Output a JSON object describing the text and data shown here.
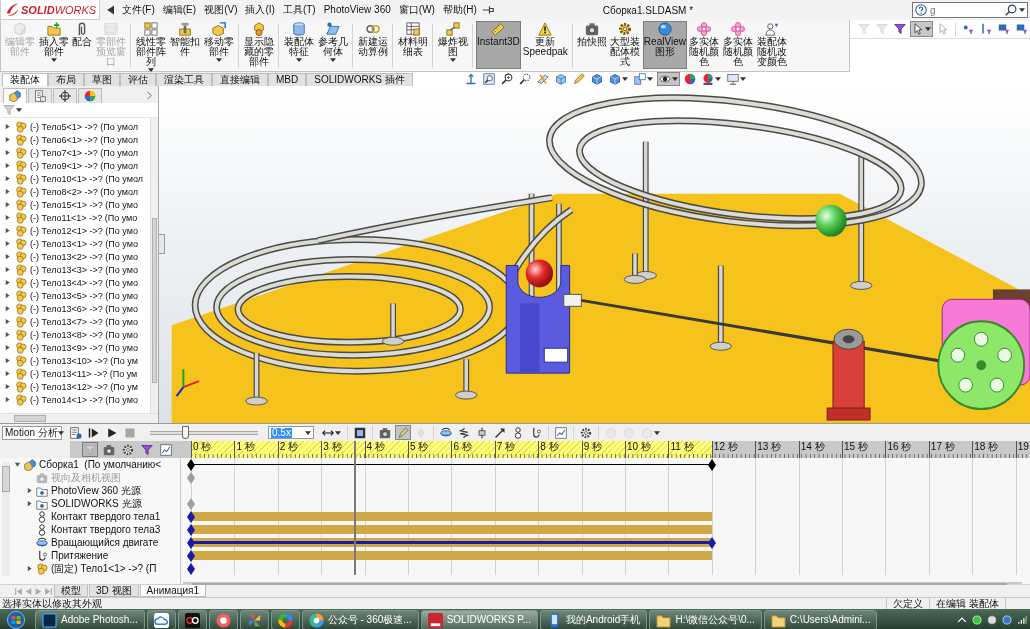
{
  "menu_bar": {
    "logo": "**SOLID**WORKS",
    "items": [
      "文件(F)",
      "编辑(E)",
      "视图(V)",
      "插入(I)",
      "工具(T)",
      "PhotoView 360",
      "窗口(W)",
      "帮助(H)"
    ]
  },
  "window": {
    "title": "Сборка1.SLDASM *"
  },
  "search": {
    "value": "g"
  },
  "command_bar": [
    {
      "label": "编辑零部件",
      "disabled": true,
      "selected": false,
      "has_menu": false
    },
    {
      "label": "插入零部件",
      "disabled": false,
      "selected": false,
      "has_menu": true
    },
    {
      "label": "配合",
      "disabled": false,
      "selected": false,
      "has_menu": false
    },
    {
      "label": "零部件预览窗口",
      "disabled": true,
      "selected": false,
      "has_menu": false
    },
    {
      "label": "线性零部件阵列",
      "disabled": false,
      "selected": false,
      "has_menu": true
    },
    {
      "label": "智能扣件",
      "disabled": false,
      "selected": false,
      "has_menu": false
    },
    {
      "label": "移动零部件",
      "disabled": false,
      "selected": false,
      "has_menu": true
    },
    {
      "label": "显示隐藏的零部件",
      "disabled": false,
      "selected": false,
      "has_menu": false
    },
    {
      "label": "装配体特征",
      "disabled": false,
      "selected": false,
      "has_menu": true
    },
    {
      "label": "参考几何体",
      "disabled": false,
      "selected": false,
      "has_menu": true
    },
    {
      "label": "新建运动算例",
      "disabled": false,
      "selected": false,
      "has_menu": false
    },
    {
      "label": "材料明细表",
      "disabled": false,
      "selected": false,
      "has_menu": false
    },
    {
      "label": "爆炸视图",
      "disabled": false,
      "selected": false,
      "has_menu": true
    },
    {
      "label": "Instant3D",
      "disabled": false,
      "selected": true,
      "has_menu": false
    },
    {
      "label": "更新Speedpak",
      "disabled": false,
      "selected": false,
      "has_menu": false
    },
    {
      "label": "拍快照",
      "disabled": false,
      "selected": false,
      "has_menu": false
    },
    {
      "label": "大型装配体模式",
      "disabled": false,
      "selected": false,
      "has_menu": false
    },
    {
      "label": "RealView图形",
      "disabled": false,
      "selected": true,
      "has_menu": false
    },
    {
      "label": "多实体随机颜色",
      "disabled": false,
      "selected": false,
      "has_menu": false
    },
    {
      "label": "多实体随机颜色",
      "disabled": false,
      "selected": false,
      "has_menu": false
    },
    {
      "label": "装配体随机改变颜色",
      "disabled": false,
      "selected": false,
      "has_menu": false
    }
  ],
  "selection_filters": [
    {
      "disabled": true,
      "selected": false,
      "has_menu": false
    },
    {
      "disabled": true,
      "selected": false,
      "has_menu": false
    },
    {
      "disabled": false,
      "selected": false,
      "has_menu": false
    },
    {
      "disabled": false,
      "selected": true,
      "has_menu": true
    },
    {
      "disabled": true,
      "selected": false,
      "has_menu": false
    },
    {
      "disabled": false,
      "selected": false,
      "has_menu": false
    },
    {
      "disabled": false,
      "selected": false,
      "has_menu": false
    },
    {
      "disabled": false,
      "selected": false,
      "has_menu": false
    },
    {
      "disabled": false,
      "selected": false,
      "has_menu": false
    }
  ],
  "command_tabs": [
    {
      "label": "装配体",
      "selected": true
    },
    {
      "label": "布局",
      "selected": false
    },
    {
      "label": "草图",
      "selected": false
    },
    {
      "label": "评估",
      "selected": false
    },
    {
      "label": "渲染工具",
      "selected": false
    },
    {
      "label": "直接编辑",
      "selected": false
    },
    {
      "label": "MBD",
      "selected": false
    },
    {
      "label": "SOLIDWORKS 插件",
      "selected": false
    }
  ],
  "view_toolbar": [
    {
      "selected": false,
      "has_menu": false
    },
    {
      "selected": false,
      "has_menu": false
    },
    {
      "selected": false,
      "has_menu": false
    },
    {
      "selected": false,
      "has_menu": false
    },
    {
      "selected": false,
      "has_menu": false
    },
    {
      "selected": false,
      "has_menu": false
    },
    {
      "selected": false,
      "has_menu": false
    },
    {
      "selected": false,
      "has_menu": false
    },
    {
      "selected": false,
      "has_menu": true
    },
    {
      "selected": false,
      "has_menu": true
    },
    {
      "selected": true,
      "has_menu": true
    },
    {
      "selected": false,
      "has_menu": false
    },
    {
      "selected": false,
      "has_menu": true
    },
    {
      "selected": false,
      "has_menu": true
    }
  ],
  "panel_tabs": [
    {
      "selected": true
    },
    {
      "selected": false
    },
    {
      "selected": false
    },
    {
      "selected": false
    }
  ],
  "feature_tree": [
    {
      "label": "(-) Тело5<1> ->? (По умол",
      "expanded": false
    },
    {
      "label": "(-) Тело6<1> ->? (По умол",
      "expanded": false
    },
    {
      "label": "(-) Тело7<1> ->? (По умол",
      "expanded": false
    },
    {
      "label": "(-) Тело9<1> ->? (По умол",
      "expanded": false
    },
    {
      "label": "(-) Тело10<1> ->? (По умол",
      "expanded": false
    },
    {
      "label": "(-) Тело8<2> ->? (По умол",
      "expanded": false
    },
    {
      "label": "(-) Тело15<1> ->? (По умо",
      "expanded": false
    },
    {
      "label": "(-) Тело11<1> ->? (По умо",
      "expanded": false
    },
    {
      "label": "(-) Тело12<1> ->? (По умо",
      "expanded": false
    },
    {
      "label": "(-) Тело13<1> ->? (По умо",
      "expanded": false
    },
    {
      "label": "(-) Тело13<2> ->? (По умо",
      "expanded": false
    },
    {
      "label": "(-) Тело13<3> ->? (По умо",
      "expanded": false
    },
    {
      "label": "(-) Тело13<4> ->? (По умо",
      "expanded": false
    },
    {
      "label": "(-) Тело13<5> ->? (По умо",
      "expanded": false
    },
    {
      "label": "(-) Тело13<6> ->? (По умо",
      "expanded": false
    },
    {
      "label": "(-) Тело13<7> ->? (По умо",
      "expanded": false
    },
    {
      "label": "(-) Тело13<8> ->? (По умо",
      "expanded": false
    },
    {
      "label": "(-) Тело13<9> ->? (По умо",
      "expanded": false
    },
    {
      "label": "(-) Тело13<10> ->? (По ум",
      "expanded": false
    },
    {
      "label": "(-) Тело13<11> ->? (По ум",
      "expanded": false
    },
    {
      "label": "(-) Тело13<12> ->? (По ум",
      "expanded": false
    },
    {
      "label": "(-) Тело14<1> ->? (По умо",
      "expanded": false
    }
  ],
  "motion": {
    "study_type": "Motion 分析",
    "playback": [
      {
        "disabled": false
      },
      {
        "disabled": false
      },
      {
        "disabled": false
      },
      {
        "disabled": true
      }
    ],
    "slider": {
      "level": 0.33
    },
    "speed": "0.5x",
    "tools": [
      {
        "selected": false,
        "disabled": false,
        "has_menu": true
      },
      {
        "selected": false,
        "disabled": false,
        "has_menu": false
      },
      {
        "selected": false,
        "disabled": false,
        "has_menu": false
      },
      {
        "selected": true,
        "disabled": false,
        "has_menu": false
      },
      {
        "selected": false,
        "disabled": true,
        "has_menu": false
      },
      {
        "selected": false,
        "disabled": false,
        "has_menu": false
      },
      {
        "selected": false,
        "disabled": false,
        "has_menu": false
      },
      {
        "selected": false,
        "disabled": false,
        "has_menu": false
      },
      {
        "selected": false,
        "disabled": false,
        "has_menu": false
      },
      {
        "selected": false,
        "disabled": false,
        "has_menu": false
      },
      {
        "selected": false,
        "disabled": false,
        "has_menu": false
      },
      {
        "selected": false,
        "disabled": false,
        "has_menu": false
      },
      {
        "selected": false,
        "disabled": false,
        "has_menu": false
      },
      {
        "selected": false,
        "disabled": true,
        "has_menu": false
      },
      {
        "selected": false,
        "disabled": true,
        "has_menu": false
      },
      {
        "selected": false,
        "disabled": true,
        "has_menu": true
      }
    ],
    "tree_filters": [
      {
        "selected": true
      },
      {
        "selected": false
      },
      {
        "selected": false
      },
      {
        "selected": false
      },
      {
        "selected": false
      }
    ],
    "tree": [
      {
        "label": "Сборка1  (По умолчанию<",
        "kind": "assembly",
        "expanded": true,
        "disabled": false,
        "bar": false,
        "line": true,
        "start_key": true,
        "end_key": true,
        "color": "#000000",
        "children": [
          {
            "label": "视向及相机视图",
            "kind": "camera",
            "disabled": true,
            "bar": false,
            "line": false,
            "start_key": true,
            "end_key": false,
            "color": "#a0a0a0"
          },
          {
            "label": "PhotoView 360 光源",
            "kind": "lights",
            "expanded": false,
            "disabled": false,
            "bar": false,
            "line": false,
            "start_key": false,
            "end_key": false
          },
          {
            "label": "SOLIDWORKS 光源",
            "kind": "lights",
            "expanded": false,
            "disabled": false,
            "bar": false,
            "line": false,
            "start_key": true,
            "end_key": false,
            "color": "#a0a0a0"
          },
          {
            "label": "Контакт твердого тела1",
            "kind": "contact",
            "disabled": false,
            "bar": true,
            "line": false,
            "start_key": true,
            "end_key": false,
            "color": "#1a1aa8"
          },
          {
            "label": "Контакт твердого тела3",
            "kind": "contact",
            "disabled": false,
            "bar": true,
            "line": false,
            "start_key": true,
            "end_key": false,
            "color": "#1a1aa8"
          },
          {
            "label": "Вращающийся двигате",
            "kind": "motor",
            "disabled": false,
            "bar": true,
            "line": true,
            "start_key": true,
            "end_key": true,
            "color": "#1a1aa8"
          },
          {
            "label": "Притяжение",
            "kind": "gravity",
            "disabled": false,
            "bar": true,
            "line": false,
            "start_key": true,
            "end_key": false,
            "color": "#1a1aa8"
          },
          {
            "label": "(固定) Тело1<1> ->? (П",
            "kind": "part",
            "expanded": false,
            "disabled": false,
            "bar": false,
            "line": false,
            "start_key": true,
            "end_key": false,
            "color": "#1a1aa8"
          }
        ]
      }
    ],
    "timeline": {
      "ticks": [
        "0 秒",
        "1 秒",
        "2 秒",
        "3 秒",
        "4 秒",
        "5 秒",
        "6 秒",
        "7 秒",
        "8 秒",
        "9 秒",
        "10 秒",
        "11 秒",
        "12 秒",
        "13 秒",
        "14 秒",
        "15 秒",
        "16 秒",
        "17 秒",
        "18 秒",
        "19"
      ],
      "level": 0.621,
      "playhead": {
        "level": 0.196
      }
    }
  },
  "model_tabs": [
    {
      "label": "模型",
      "selected": false
    },
    {
      "label": "3D 视图",
      "selected": false
    },
    {
      "label": "Анимация1",
      "selected": true
    }
  ],
  "status_bar": {
    "message": "选择实体以修改其外观",
    "fields": [
      "欠定义",
      "在编辑 装配体"
    ]
  },
  "taskbar": [
    {
      "kind": "photoshop",
      "label": "Adobe Photosh...",
      "selected": false
    },
    {
      "kind": "cloud",
      "selected": false
    },
    {
      "kind": "player",
      "selected": false
    },
    {
      "kind": "capture",
      "selected": false
    },
    {
      "kind": "pinwheel",
      "selected": false
    },
    {
      "kind": "colorwheel",
      "selected": false
    },
    {
      "kind": "browser",
      "label": "公众号 - 360极速...",
      "selected": false
    },
    {
      "kind": "solidworks",
      "label": "SOLIDWORKS P...",
      "selected": true
    },
    {
      "kind": "phone",
      "label": "我的Android手机",
      "selected": false
    },
    {
      "kind": "folder",
      "label": "H:\\微信公众号\\0...",
      "selected": false
    },
    {
      "kind": "folder",
      "label": "C:\\Users\\Admini...",
      "selected": false
    }
  ]
}
